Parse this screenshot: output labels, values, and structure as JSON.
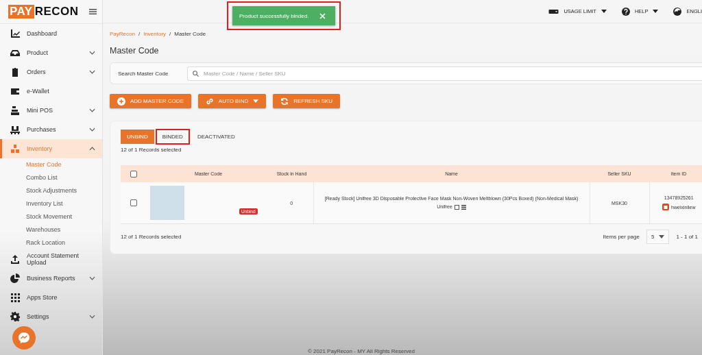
{
  "logo": {
    "brand_left": "PAY",
    "brand_right": "RECON"
  },
  "sidebar": {
    "items": [
      {
        "label": "Dashboard",
        "kind": "chart",
        "expandable": false,
        "selected": false
      },
      {
        "label": "Product",
        "kind": "tray",
        "expandable": true,
        "expanded": false,
        "selected": false
      },
      {
        "label": "Orders",
        "kind": "clipboard",
        "expandable": true,
        "expanded": false,
        "selected": false
      },
      {
        "label": "e-Wallet",
        "kind": "wallet",
        "expandable": false,
        "selected": false
      },
      {
        "label": "Mini POS",
        "kind": "register",
        "expandable": true,
        "expanded": false,
        "selected": false
      },
      {
        "label": "Purchases",
        "kind": "pallet",
        "expandable": true,
        "expanded": false,
        "selected": false
      },
      {
        "label": "Inventory",
        "kind": "boxes",
        "expandable": true,
        "expanded": true,
        "selected": true,
        "children": [
          {
            "label": "Master Code",
            "selected": true
          },
          {
            "label": "Combo List",
            "selected": false
          },
          {
            "label": "Stock Adjustments",
            "selected": false
          },
          {
            "label": "Inventory List",
            "selected": false
          },
          {
            "label": "Stock Movement",
            "selected": false
          },
          {
            "label": "Warehouses",
            "selected": false
          },
          {
            "label": "Rack Location",
            "selected": false
          }
        ]
      },
      {
        "label": "Account Statement Upload",
        "kind": "upload",
        "expandable": false,
        "selected": false
      },
      {
        "label": "Business Reports",
        "kind": "pie",
        "expandable": true,
        "expanded": false,
        "selected": false
      },
      {
        "label": "Apps Store",
        "kind": "grid",
        "expandable": false,
        "selected": false
      },
      {
        "label": "Settings",
        "kind": "gear",
        "expandable": true,
        "expanded": false,
        "selected": false
      }
    ]
  },
  "topbar": {
    "items": [
      {
        "label": "USAGE LIMIT",
        "kind": "usage"
      },
      {
        "label": "HELP",
        "kind": "help"
      },
      {
        "label": "ENGLI",
        "kind": "language"
      }
    ]
  },
  "toast": {
    "message": "Product successfully binded.",
    "highlighted": true
  },
  "breadcrumb": {
    "separator": "/",
    "items": [
      {
        "label": "PayRecon",
        "link": true
      },
      {
        "label": "Inventory",
        "link": true
      },
      {
        "label": "Master Code",
        "link": false
      }
    ]
  },
  "page_title": "Master Code",
  "search": {
    "label": "Search Master Code",
    "placeholder": "Master Code / Name / Seller SKU"
  },
  "actions": [
    {
      "label": "ADD MASTER CODE",
      "kind": "add",
      "dropdown": false
    },
    {
      "label": "AUTO BIND",
      "kind": "link",
      "dropdown": true
    },
    {
      "label": "REFRESH SKU",
      "kind": "refresh",
      "dropdown": false
    }
  ],
  "tabs": [
    {
      "label": "UNBIND",
      "selected": true,
      "highlighted": false
    },
    {
      "label": "BINDED",
      "selected": false,
      "highlighted": true
    },
    {
      "label": "DEACTIVATED",
      "selected": false,
      "highlighted": false
    }
  ],
  "selection_summary": "12 of 1 Records selected",
  "table": {
    "header_checked": false,
    "columns": [
      "Master Code",
      "Stock in Hand",
      "Name",
      "Seller SKU",
      "Item ID"
    ],
    "rows": [
      {
        "checked": false,
        "badge": "Unbind",
        "stock_in_hand": "0",
        "name": "[Ready Stock] Unifree 3D Disposable Protective Face Mask Non-Woven Meltblown (30Pcs Boxed) (Non-Medical Mask)",
        "brand": "Unifree",
        "seller_sku": "MSK30",
        "item_id": "13478925261",
        "shop": "hweixinliew"
      }
    ]
  },
  "footer_summary": "12 of 1 Records selected",
  "pagination": {
    "label": "Items per page",
    "page_size": "5",
    "range": "1 - 1 of 1"
  },
  "copyright": "© 2021 PayRecon - MY All Rights Reserved"
}
